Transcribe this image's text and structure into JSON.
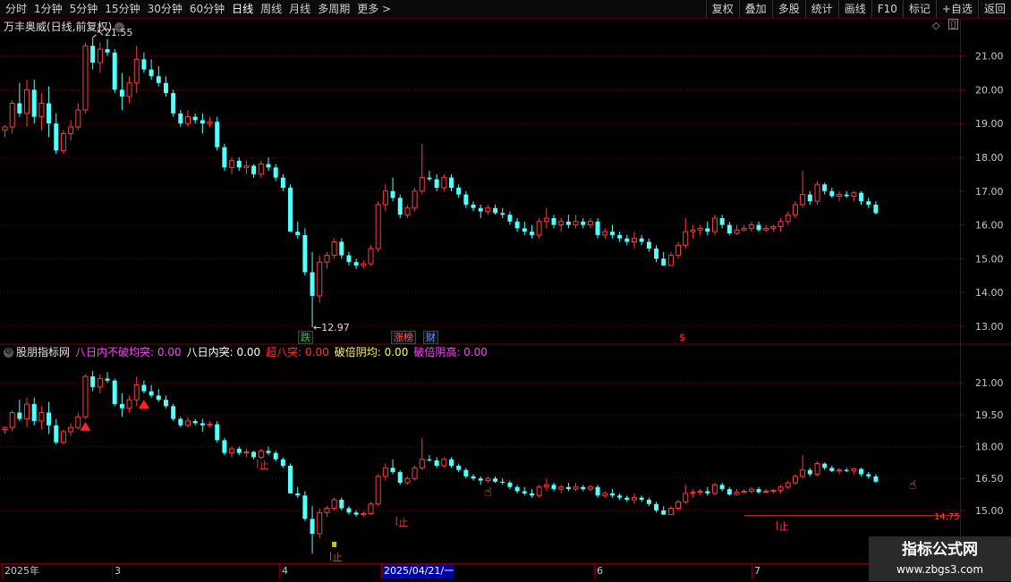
{
  "toolbar": {
    "periods": [
      "分时",
      "1分钟",
      "5分钟",
      "15分钟",
      "30分钟",
      "60分钟",
      "日线",
      "周线",
      "月线",
      "多周期",
      "更多"
    ],
    "active_period": "日线",
    "more_arrow": ">",
    "actions": [
      "复权",
      "叠加",
      "多股",
      "统计",
      "画线",
      "F10",
      "标记",
      "+自选",
      "返回"
    ]
  },
  "main_panel": {
    "title": "万丰奥威(日线,前复权)",
    "high_marker": "21.55",
    "low_marker": "12.97",
    "event_tags": [
      {
        "text": "跌",
        "color": "#22cc22"
      },
      {
        "text": "涨榜",
        "color": "#ff5555"
      },
      {
        "text": "财",
        "color": "#6699ff"
      },
      {
        "text": "$",
        "color": "#ff3333"
      }
    ]
  },
  "indicator_panel": {
    "name": "股朋指标网",
    "labels": [
      {
        "text": "八日内不破均突: 0.00",
        "color": "#ff44ff"
      },
      {
        "text": "八日内突: 0.00",
        "color": "#ffffff"
      },
      {
        "text": "超八突: 0.00",
        "color": "#ff3333"
      },
      {
        "text": "破倍阴均: 0.00",
        "color": "#ffff44"
      },
      {
        "text": "破倍阴高: 0.00",
        "color": "#ff44ff"
      }
    ],
    "stop_label": "止",
    "level_label": "14.75"
  },
  "x_axis": {
    "labels": [
      "2025年",
      "3",
      "4",
      "2025/04/21/一",
      "6",
      "7"
    ],
    "selected": "2025/04/21/一"
  },
  "watermark": {
    "line1": "指标公式网",
    "line2": "www.zbgs3.com"
  },
  "colors": {
    "up": "#ff3b3b",
    "down": "#54ffff",
    "grid": "#7a0000",
    "axis_text": "#c8c8c8"
  },
  "chart_data": [
    {
      "type": "candlestick",
      "name": "main",
      "y_ticks": [
        21,
        20,
        19,
        18,
        17,
        16,
        15,
        14,
        13
      ],
      "ylim": [
        12.55,
        22.1
      ],
      "candles": [
        [
          18.8,
          18.95,
          18.6,
          18.9
        ],
        [
          18.9,
          19.7,
          18.7,
          19.6
        ],
        [
          19.6,
          20.2,
          19.2,
          19.3
        ],
        [
          19.3,
          20.3,
          18.9,
          20.0
        ],
        [
          20.0,
          20.3,
          19.0,
          19.2
        ],
        [
          19.2,
          19.9,
          18.8,
          19.6
        ],
        [
          19.6,
          20.1,
          18.6,
          19.0
        ],
        [
          19.0,
          19.3,
          18.1,
          18.2
        ],
        [
          18.2,
          18.8,
          18.1,
          18.7
        ],
        [
          18.7,
          19.1,
          18.5,
          18.9
        ],
        [
          18.9,
          19.6,
          18.8,
          19.4
        ],
        [
          19.4,
          21.4,
          19.3,
          21.3
        ],
        [
          21.3,
          21.55,
          20.6,
          20.8
        ],
        [
          20.8,
          21.4,
          20.5,
          21.2
        ],
        [
          21.2,
          21.5,
          21.0,
          21.1
        ],
        [
          21.1,
          21.2,
          19.9,
          20.0
        ],
        [
          20.0,
          20.5,
          19.4,
          19.8
        ],
        [
          19.8,
          20.4,
          19.6,
          20.2
        ],
        [
          20.2,
          21.3,
          19.9,
          20.9
        ],
        [
          20.9,
          21.1,
          20.5,
          20.6
        ],
        [
          20.6,
          20.9,
          20.3,
          20.4
        ],
        [
          20.4,
          20.7,
          20.1,
          20.2
        ],
        [
          20.2,
          20.4,
          19.8,
          19.9
        ],
        [
          19.9,
          20.0,
          19.2,
          19.3
        ],
        [
          19.3,
          19.4,
          18.9,
          19.0
        ],
        [
          19.0,
          19.4,
          18.9,
          19.2
        ],
        [
          19.2,
          19.3,
          19.0,
          19.1
        ],
        [
          19.1,
          19.3,
          18.7,
          19.0
        ],
        [
          19.0,
          19.2,
          18.9,
          19.05
        ],
        [
          19.05,
          19.2,
          18.2,
          18.3
        ],
        [
          18.3,
          18.4,
          17.6,
          17.7
        ],
        [
          17.7,
          18.0,
          17.5,
          17.9
        ],
        [
          17.9,
          18.0,
          17.6,
          17.7
        ],
        [
          17.7,
          17.9,
          17.5,
          17.75
        ],
        [
          17.75,
          17.8,
          17.4,
          17.5
        ],
        [
          17.5,
          17.9,
          17.4,
          17.8
        ],
        [
          17.8,
          18.0,
          17.6,
          17.7
        ],
        [
          17.7,
          17.8,
          17.3,
          17.4
        ],
        [
          17.4,
          17.5,
          17.0,
          17.1
        ],
        [
          17.1,
          17.2,
          16.5,
          15.8
        ],
        [
          15.8,
          16.1,
          15.6,
          15.7
        ],
        [
          15.7,
          15.9,
          14.5,
          14.6
        ],
        [
          14.6,
          15.2,
          12.97,
          13.9
        ],
        [
          13.9,
          15.1,
          13.7,
          14.9
        ],
        [
          14.9,
          15.2,
          14.7,
          15.1
        ],
        [
          15.1,
          15.6,
          15.0,
          15.5
        ],
        [
          15.5,
          15.6,
          15.0,
          15.1
        ],
        [
          15.1,
          15.2,
          14.8,
          14.9
        ],
        [
          14.9,
          15.0,
          14.7,
          14.8
        ],
        [
          14.8,
          14.95,
          14.7,
          14.85
        ],
        [
          14.85,
          15.4,
          14.8,
          15.3
        ],
        [
          15.3,
          16.7,
          15.2,
          16.6
        ],
        [
          16.6,
          17.2,
          16.4,
          17.0
        ],
        [
          17.0,
          17.4,
          16.7,
          16.8
        ],
        [
          16.8,
          16.9,
          16.2,
          16.3
        ],
        [
          16.3,
          16.6,
          16.2,
          16.5
        ],
        [
          16.5,
          17.1,
          16.4,
          17.0
        ],
        [
          17.0,
          18.4,
          16.9,
          17.4
        ],
        [
          17.4,
          17.6,
          17.3,
          17.35
        ],
        [
          17.35,
          17.5,
          17.0,
          17.1
        ],
        [
          17.1,
          17.5,
          17.0,
          17.4
        ],
        [
          17.4,
          17.5,
          17.0,
          17.1
        ],
        [
          17.1,
          17.2,
          16.8,
          16.9
        ],
        [
          16.9,
          17.0,
          16.5,
          16.6
        ],
        [
          16.6,
          16.7,
          16.4,
          16.5
        ],
        [
          16.5,
          16.6,
          16.2,
          16.4
        ],
        [
          16.4,
          16.6,
          16.3,
          16.5
        ],
        [
          16.5,
          16.6,
          16.3,
          16.35
        ],
        [
          16.35,
          16.5,
          16.2,
          16.3
        ],
        [
          16.3,
          16.4,
          16.0,
          16.1
        ],
        [
          16.1,
          16.2,
          15.8,
          15.9
        ],
        [
          15.9,
          16.1,
          15.7,
          15.8
        ],
        [
          15.8,
          16.0,
          15.6,
          15.7
        ],
        [
          15.7,
          16.2,
          15.6,
          16.1
        ],
        [
          16.1,
          16.5,
          15.9,
          16.2
        ],
        [
          16.2,
          16.3,
          15.9,
          16.0
        ],
        [
          16.0,
          16.2,
          15.8,
          16.1
        ],
        [
          16.1,
          16.3,
          15.9,
          16.0
        ],
        [
          16.0,
          16.3,
          15.9,
          16.1
        ],
        [
          16.1,
          16.2,
          15.9,
          16.0
        ],
        [
          16.0,
          16.2,
          15.9,
          16.1
        ],
        [
          16.1,
          16.2,
          15.6,
          15.7
        ],
        [
          15.7,
          15.9,
          15.6,
          15.8
        ],
        [
          15.8,
          16.0,
          15.6,
          15.7
        ],
        [
          15.7,
          15.8,
          15.5,
          15.6
        ],
        [
          15.6,
          15.7,
          15.4,
          15.5
        ],
        [
          15.5,
          15.8,
          15.3,
          15.6
        ],
        [
          15.6,
          15.7,
          15.4,
          15.5
        ],
        [
          15.5,
          15.6,
          15.2,
          15.3
        ],
        [
          15.3,
          15.4,
          14.9,
          15.0
        ],
        [
          15.0,
          15.2,
          14.8,
          14.8
        ],
        [
          14.8,
          15.2,
          14.8,
          15.1
        ],
        [
          15.1,
          15.5,
          15.0,
          15.4
        ],
        [
          15.4,
          16.2,
          15.3,
          15.8
        ],
        [
          15.8,
          16.0,
          15.6,
          15.85
        ],
        [
          15.85,
          16.0,
          15.7,
          15.9
        ],
        [
          15.9,
          16.1,
          15.7,
          15.8
        ],
        [
          15.8,
          16.3,
          15.7,
          16.2
        ],
        [
          16.2,
          16.3,
          15.9,
          16.0
        ],
        [
          16.0,
          16.1,
          15.7,
          15.75
        ],
        [
          15.75,
          16.0,
          15.7,
          15.85
        ],
        [
          15.85,
          16.0,
          15.8,
          15.9
        ],
        [
          15.9,
          16.1,
          15.8,
          16.0
        ],
        [
          16.0,
          16.1,
          15.8,
          15.85
        ],
        [
          15.85,
          16.0,
          15.8,
          15.9
        ],
        [
          15.9,
          16.0,
          15.8,
          15.95
        ],
        [
          15.95,
          16.2,
          15.8,
          16.1
        ],
        [
          16.1,
          16.4,
          16.0,
          16.3
        ],
        [
          16.3,
          16.7,
          16.2,
          16.6
        ],
        [
          16.6,
          17.6,
          16.5,
          16.9
        ],
        [
          16.9,
          17.0,
          16.6,
          16.7
        ],
        [
          16.7,
          17.3,
          16.6,
          17.2
        ],
        [
          17.2,
          17.25,
          16.9,
          17.0
        ],
        [
          17.0,
          17.1,
          16.8,
          16.85
        ],
        [
          16.85,
          17.0,
          16.7,
          16.9
        ],
        [
          16.9,
          17.0,
          16.8,
          16.85
        ],
        [
          16.85,
          17.0,
          16.7,
          16.95
        ],
        [
          16.95,
          17.0,
          16.6,
          16.7
        ],
        [
          16.7,
          16.8,
          16.5,
          16.6
        ],
        [
          16.6,
          16.7,
          16.3,
          16.35
        ]
      ]
    },
    {
      "type": "candlestick",
      "name": "indicator",
      "y_ticks": [
        21.0,
        19.5,
        18.0,
        16.5,
        15.0
      ],
      "ylim": [
        12.6,
        22.1
      ],
      "candles_from": "main",
      "markers": [
        {
          "kind": "up-triangle",
          "index": 11,
          "value": 18.95,
          "color": "#ff2222"
        },
        {
          "kind": "up-triangle",
          "index": 19,
          "value": 20.0,
          "color": "#ff2222"
        },
        {
          "kind": "hand",
          "index": 66,
          "value": 16.0,
          "color": "#ffb040"
        },
        {
          "kind": "hand",
          "index": 124,
          "value": 16.35,
          "color": "#ffb040"
        }
      ],
      "stops": [
        {
          "index": 35,
          "value": 17.15
        },
        {
          "index": 54,
          "value": 14.45
        },
        {
          "index": 45,
          "value": 12.8
        },
        {
          "index": 106,
          "value": 14.25
        }
      ],
      "yellow_box": {
        "index": 45,
        "value": 13.4
      },
      "level": {
        "value": 14.75,
        "from_index": 101
      }
    }
  ]
}
